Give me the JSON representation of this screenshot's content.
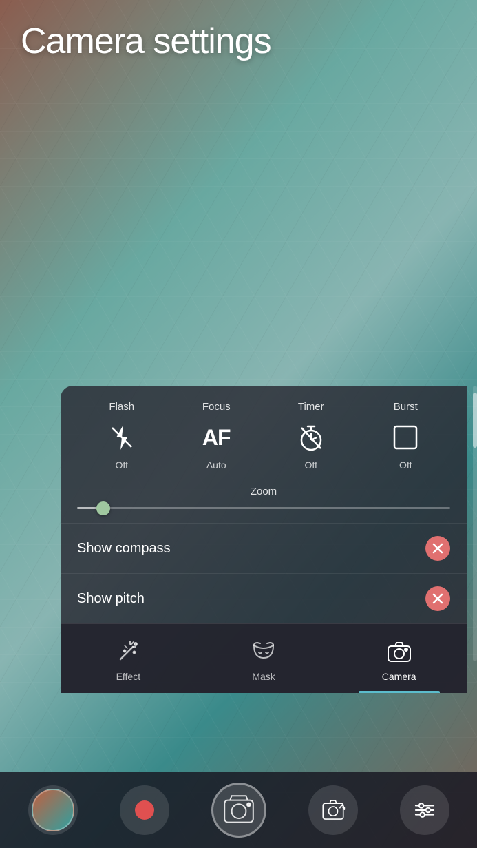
{
  "page": {
    "title": "Camera settings",
    "background": {
      "colors": [
        "#b45040",
        "#78b4aa",
        "#c8dcd7",
        "#3c8c8c"
      ]
    }
  },
  "settings_panel": {
    "controls": [
      {
        "id": "flash",
        "label": "Flash",
        "icon": "flash-off-icon",
        "value": "Off"
      },
      {
        "id": "focus",
        "label": "Focus",
        "icon": "af-icon",
        "value": "Auto"
      },
      {
        "id": "timer",
        "label": "Timer",
        "icon": "timer-icon",
        "value": "Off"
      },
      {
        "id": "burst",
        "label": "Burst",
        "icon": "burst-icon",
        "value": "Off"
      }
    ],
    "zoom": {
      "label": "Zoom",
      "value": 7,
      "min": 0,
      "max": 100
    },
    "toggles": [
      {
        "id": "show-compass",
        "label": "Show compass",
        "state": "off"
      },
      {
        "id": "show-pitch",
        "label": "Show pitch",
        "state": "off"
      }
    ],
    "tabs": [
      {
        "id": "effect",
        "label": "Effect",
        "icon": "effect-icon",
        "active": false
      },
      {
        "id": "mask",
        "label": "Mask",
        "icon": "mask-icon",
        "active": false
      },
      {
        "id": "camera",
        "label": "Camera",
        "icon": "camera-icon",
        "active": true
      }
    ]
  },
  "bottom_nav": {
    "items": [
      {
        "id": "thumbnail",
        "label": "Thumbnail",
        "icon": "thumbnail-icon"
      },
      {
        "id": "record",
        "label": "Record",
        "icon": "record-icon"
      },
      {
        "id": "capture",
        "label": "Capture",
        "icon": "capture-icon"
      },
      {
        "id": "selfie",
        "label": "Selfie",
        "icon": "selfie-icon"
      },
      {
        "id": "settings",
        "label": "Settings",
        "icon": "settings-icon"
      }
    ]
  }
}
